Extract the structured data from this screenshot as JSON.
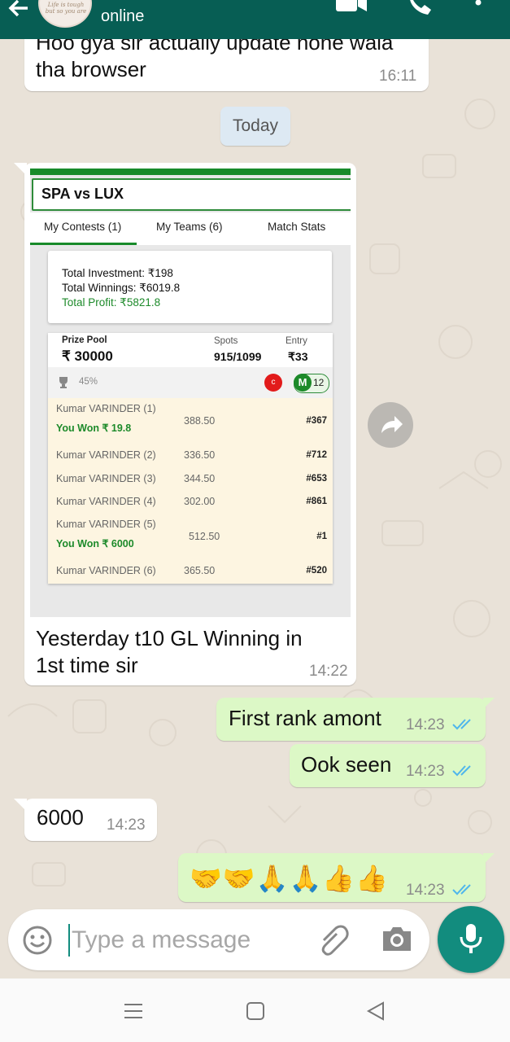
{
  "header": {
    "contact_status": "online",
    "avatar_caption": "Life is tough but so you are",
    "icons": [
      "back-arrow-icon",
      "video-call-icon",
      "voice-call-icon",
      "more-vert-icon"
    ]
  },
  "messages": {
    "m1": {
      "text_line1": "Hoo gya sir actually update none wala",
      "text_line2": "tha browser",
      "time": "16:11"
    },
    "date_chip": "Today",
    "m2": {
      "caption_line1": "Yesterday t10 GL Winning in",
      "caption_line2": "1st time sir",
      "time": "14:22",
      "image": {
        "match_title": "SPA vs LUX",
        "tabs": [
          "My Contests (1)",
          "My Teams (6)",
          "Match Stats"
        ],
        "summary": {
          "investment": "Total Investment: ₹198",
          "winnings": "Total Winnings: ₹6019.8",
          "profit": "Total Profit: ₹5821.8"
        },
        "pool": {
          "prize_label": "Prize Pool",
          "prize_value": "₹ 30000",
          "spots_label": "Spots",
          "spots_value": "915/1099",
          "entry_label": "Entry",
          "entry_value": "₹33",
          "percent": "45%",
          "c_badge": "c",
          "m_badge": "M",
          "m_count": "12"
        },
        "rows": [
          {
            "name": "Kumar VARINDER (1)",
            "won": "You Won ₹ 19.8",
            "points": "388.50",
            "rank": "#367"
          },
          {
            "name": "Kumar VARINDER (2)",
            "won": "",
            "points": "336.50",
            "rank": "#712"
          },
          {
            "name": "Kumar VARINDER (3)",
            "won": "",
            "points": "344.50",
            "rank": "#653"
          },
          {
            "name": "Kumar VARINDER (4)",
            "won": "",
            "points": "302.00",
            "rank": "#861"
          },
          {
            "name": "Kumar VARINDER (5)",
            "won": "You Won ₹ 6000",
            "points": "512.50",
            "rank": "#1"
          },
          {
            "name": "Kumar VARINDER (6)",
            "won": "",
            "points": "365.50",
            "rank": "#520"
          }
        ]
      }
    },
    "m3": {
      "text": "First rank amont",
      "time": "14:23"
    },
    "m4": {
      "text": "Ook seen",
      "time": "14:23"
    },
    "m5": {
      "text": "6000",
      "time": "14:23"
    },
    "m6": {
      "text": "🤝🤝🙏🙏👍👍",
      "time": "14:23"
    }
  },
  "composer": {
    "placeholder": "Type a message",
    "icons": [
      "emoji-icon",
      "attach-icon",
      "camera-icon",
      "mic-icon"
    ]
  },
  "navbar": {
    "icons": [
      "menu-icon",
      "home-icon",
      "back-icon"
    ]
  },
  "colors": {
    "header": "#075e54",
    "outgoing": "#dcf8c6",
    "incoming": "#ffffff",
    "accent": "#128c7e",
    "tick": "#4fb6ec"
  }
}
